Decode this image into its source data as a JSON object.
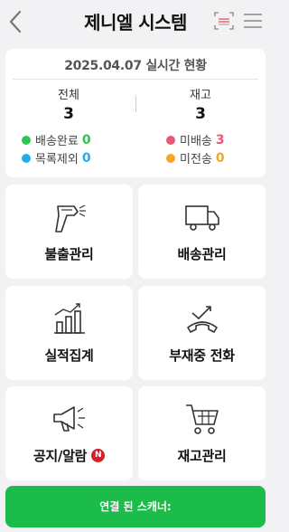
{
  "header": {
    "title": "제니엘 시스템",
    "back_icon": "chevron-left-icon",
    "scan_icon": "barcode-scan-icon",
    "menu_icon": "hamburger-menu-icon"
  },
  "stats": {
    "date_label": "2025.04.07 실시간 현황",
    "total_label": "전체",
    "total_value": "3",
    "stock_label": "재고",
    "stock_value": "3",
    "legend": [
      {
        "label": "배송완료",
        "value": "0",
        "color": "#2bc653"
      },
      {
        "label": "미배송",
        "value": "3",
        "color": "#e8577a"
      },
      {
        "label": "목록제외",
        "value": "0",
        "color": "#20b0e8"
      },
      {
        "label": "미전송",
        "value": "0",
        "color": "#f5a623"
      }
    ]
  },
  "tiles": [
    {
      "label": "불출관리",
      "icon": "barcode-scanner-icon"
    },
    {
      "label": "배송관리",
      "icon": "delivery-truck-icon"
    },
    {
      "label": "실적집계",
      "icon": "bar-chart-icon"
    },
    {
      "label": "부재중 전화",
      "icon": "missed-call-icon"
    },
    {
      "label": "공지/알람",
      "icon": "megaphone-icon",
      "badge": "N"
    },
    {
      "label": "재고관리",
      "icon": "shopping-cart-icon"
    }
  ],
  "bottom_button": {
    "label": "연결 된 스캐너:"
  },
  "colors": {
    "accent": "#1cbc4a",
    "background": "#f2f2f4",
    "badge": "#d81f26"
  }
}
